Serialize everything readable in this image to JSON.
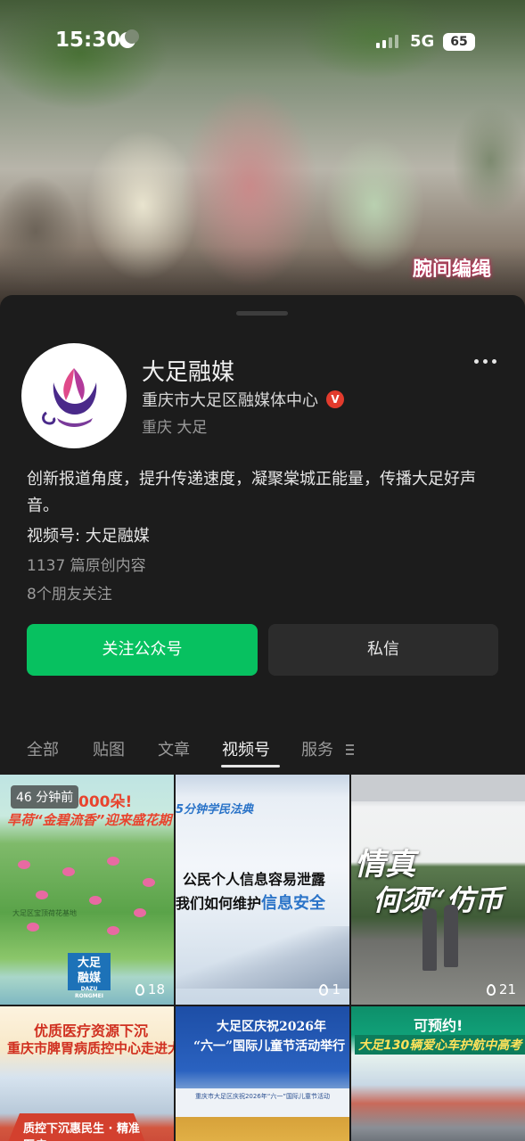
{
  "status_bar": {
    "time": "15:30",
    "network": "5G",
    "battery": "65"
  },
  "hero": {
    "caption": "腕间编绳"
  },
  "profile": {
    "name": "大足融媒",
    "organization": "重庆市大足区融媒体中心",
    "verified_mark": "V",
    "location": "重庆 大足",
    "description": "创新报道角度，提升传递速度，凝聚棠城正能量，传播大足好声音。",
    "channel": "视频号: 大足融媒",
    "original_count": "1137 篇原创内容",
    "friends_following": "8个朋友关注"
  },
  "actions": {
    "follow_label": "关注公众号",
    "message_label": "私信"
  },
  "tabs": [
    {
      "label": "全部"
    },
    {
      "label": "贴图"
    },
    {
      "label": "文章"
    },
    {
      "label": "视频号"
    },
    {
      "label": "服务"
    }
  ],
  "active_tab": "视频号",
  "videos": [
    {
      "time_badge": "46 分钟前",
      "title_line1": "000朵!",
      "title_line2": "旱荷“金碧流香”迎来盛花期",
      "subtitle": "大足区宝顶荷花基地",
      "logo": "大足",
      "logo2": "融媒",
      "logo_sub": "DAZU RONGMEI",
      "likes": "18"
    },
    {
      "banner": "5分钟学民法典",
      "line1": "公民个人信息容易泄露",
      "line2_a": "我们如何维护",
      "line2_b": "信息安全",
      "likes": "1"
    },
    {
      "cal1": "情真",
      "cal2": "何须“仿币",
      "likes": "21"
    },
    {
      "line1": "优质医疗资源下沉",
      "line2": "重庆市脾胃病质控中心走进大足",
      "tent": "质控下沉惠民生 · 精准医疗"
    },
    {
      "line1": "大足区庆祝2026年",
      "line2": "“六一”国际儿童节活动举行",
      "banner_text": "重庆市大足区庆祝2026年“六一”国际儿童节活动"
    },
    {
      "line1": "可预约!",
      "line2": "大足130辆爱心车护航中高考"
    }
  ],
  "colors": {
    "accent_green": "#07c160",
    "background": "#1c1c1c",
    "verified_red": "#e23b2d"
  }
}
